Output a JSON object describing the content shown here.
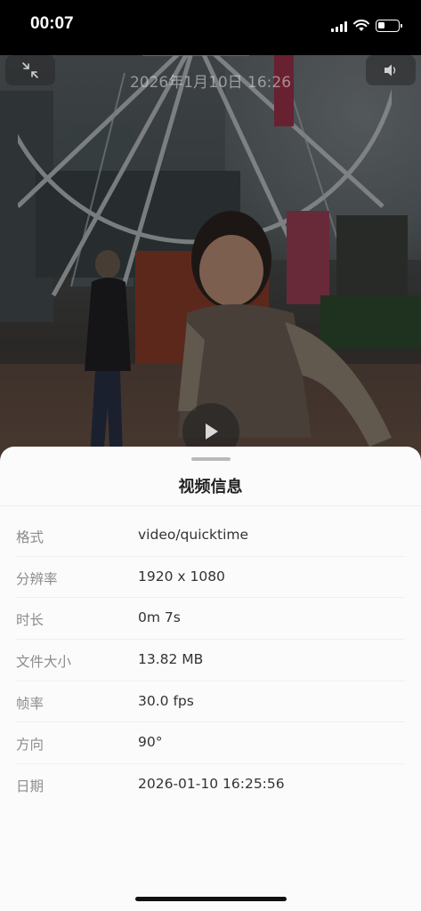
{
  "status_bar": {
    "time": "00:07",
    "icons": [
      "cellular-signal-icon",
      "wifi-icon",
      "battery-icon"
    ],
    "battery_level": 0.35
  },
  "video": {
    "date_overlay": "2026年1月10日 16:26",
    "top_left_icon": "collapse-icon",
    "top_right_icon": "speaker-icon",
    "center_icon": "play-icon"
  },
  "sheet": {
    "title": "视频信息",
    "rows": [
      {
        "label": "格式",
        "value": "video/quicktime"
      },
      {
        "label": "分辨率",
        "value": "1920 x 1080"
      },
      {
        "label": "时长",
        "value": "0m 7s"
      },
      {
        "label": "文件大小",
        "value": "13.82 MB"
      },
      {
        "label": "帧率",
        "value": "30.0 fps"
      },
      {
        "label": "方向",
        "value": "90°"
      },
      {
        "label": "日期",
        "value": "2026-01-10 16:25:56"
      }
    ]
  },
  "colors": {
    "sheet_background": "#fcfbfb",
    "label_color": "#8c8c8c",
    "value_color": "#333333"
  }
}
